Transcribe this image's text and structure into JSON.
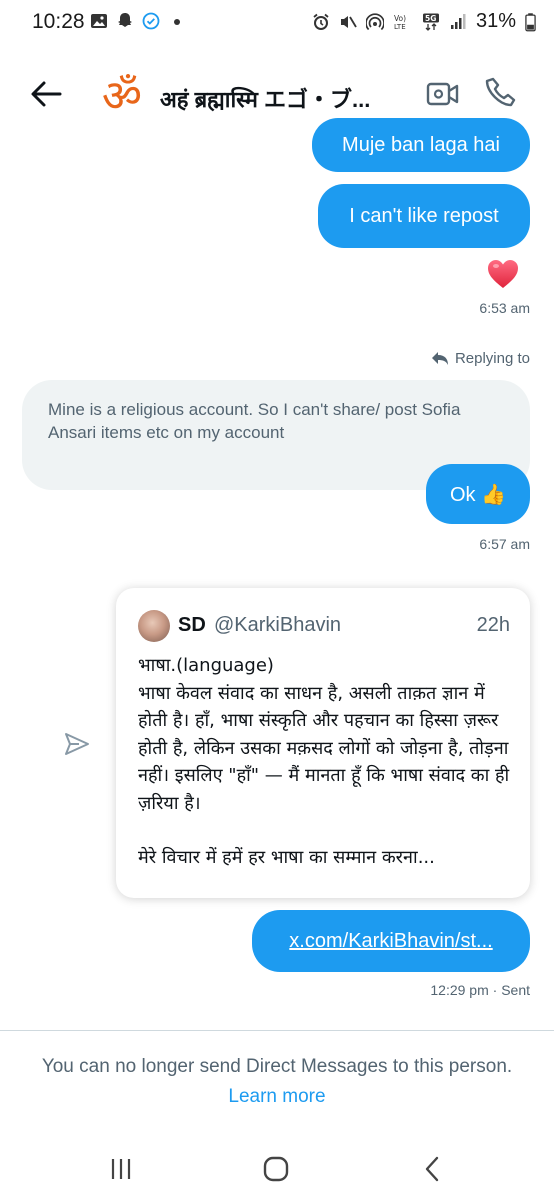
{
  "status_bar": {
    "time": "10:28",
    "battery": "31%",
    "left_icons": [
      "gallery-icon",
      "snapchat-icon",
      "check-badge-icon",
      "dot-icon"
    ],
    "right_icons": [
      "alarm-icon",
      "mute-icon",
      "hotspot-icon",
      "volte-icon",
      "5g-icon",
      "signal-icon",
      "battery-icon"
    ]
  },
  "header": {
    "avatar_symbol": "ॐ",
    "title": "अहं ब्रह्मास्मि エゴ・ブ..."
  },
  "messages": {
    "sent_1": "Muje ban laga hai",
    "sent_2": "I can't like repost",
    "reaction": "heart",
    "time_1": "6:53 am",
    "replying_to": "Replying to",
    "received_1": "Mine is a religious account. So I can't share/ post Sofia Ansari items etc on my account",
    "sent_3": "Ok 👍",
    "time_2": "6:57 am",
    "link": "x.com/KarkiBhavin/st...",
    "time_3": "12:29 pm · Sent"
  },
  "tweet": {
    "name": "SD",
    "handle": "@KarkiBhavin",
    "age": "22h",
    "line_1": "भाषा.(language)",
    "line_2": "भाषा केवल संवाद का साधन है, असली ताक़त ज्ञान में होती है। हाँ, भाषा संस्कृति और पहचान का हिस्सा ज़रूर होती है, लेकिन उसका मक़सद लोगों को जोड़ना है, तोड़ना नहीं। इसलिए \"हाँ\" — मैं मानता हूँ कि भाषा संवाद का ही ज़रिया है।",
    "line_3": "मेरे विचार में हमें हर भाषा का सम्मान करना..."
  },
  "notice": {
    "text": "You can no longer send Direct Messages to this person.",
    "link": "Learn more"
  },
  "colors": {
    "accent": "#1d9bf0",
    "received_bg": "#eff3f4",
    "muted_text": "#536471",
    "om": "#e8661a"
  }
}
